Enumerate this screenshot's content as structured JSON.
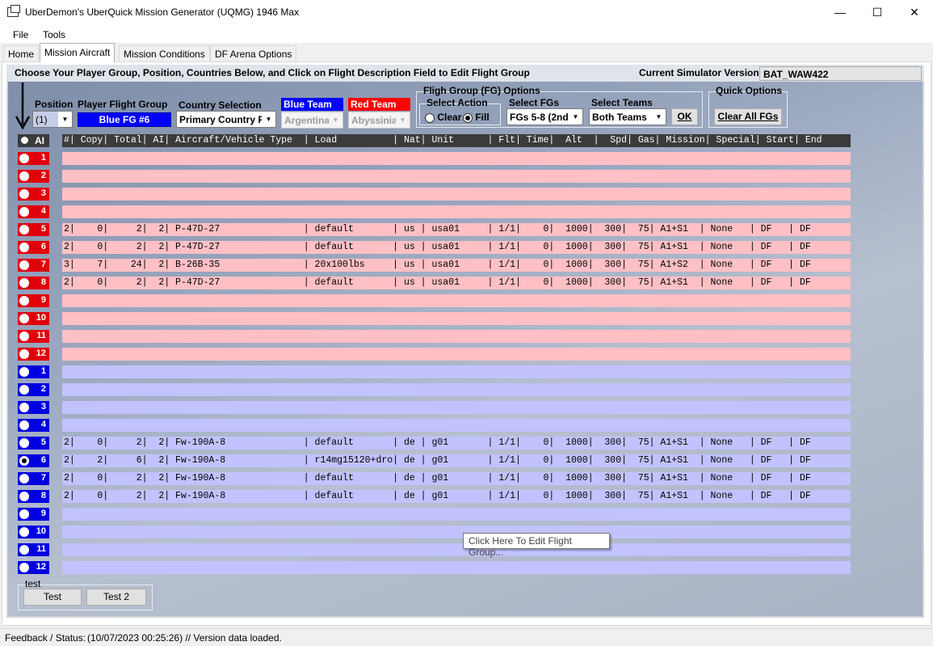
{
  "window": {
    "title": "UberDemon's UberQuick Mission Generator (UQMG) 1946 Max",
    "minimize": "—",
    "maximize": "☐",
    "close": "✕"
  },
  "menu": {
    "file": "File",
    "tools": "Tools"
  },
  "tabs": [
    "Home",
    "Mission Aircraft",
    "Mission Conditions",
    "DF Arena Options"
  ],
  "header": {
    "instructions": "Choose Your Player Group, Position, Countries Below, and Click on Flight Description Field to Edit Flight Group",
    "sim_label": "Current Simulator Version:",
    "sim_value": "BAT_WAW422"
  },
  "controls": {
    "position_label": "Position",
    "position_value": "(1)",
    "player_fg_label": "Player Flight Group",
    "player_fg_value": "Blue FG #6",
    "country_label": "Country Selection",
    "country_value": "Primary Country F",
    "blue_team_label": "Blue Team",
    "blue_team_value": "Argentina",
    "red_team_label": "Red Team",
    "red_team_value": "Abyssinia",
    "fg_options_title": "Fligh Group (FG) Options",
    "select_action_title": "Select Action",
    "clear_label": "Clear",
    "fill_label": "Fill",
    "select_fgs_label": "Select FGs",
    "select_fgs_value": "FGs 5-8  (2nd",
    "select_teams_label": "Select Teams",
    "select_teams_value": "Both Teams",
    "ok_label": "OK",
    "quick_options_title": "Quick Options",
    "clear_all_label": "Clear All FGs"
  },
  "colors": {
    "red_team": "#e0000b",
    "blue_team": "#0000e0",
    "red_row": "#ffc0c5",
    "blue_row": "#c2c2ff"
  },
  "table": {
    "all_label": "AI",
    "header": "#| Copy| Total| AI| Aircraft/Vehicle Type  | Load          | Nat| Unit      | Flt| Time|  Alt  |  Spd| Gas| Mission| Special| Start| End",
    "red_rows": [
      {
        "num": "1",
        "text": ""
      },
      {
        "num": "2",
        "text": ""
      },
      {
        "num": "3",
        "text": ""
      },
      {
        "num": "4",
        "text": ""
      },
      {
        "num": "5",
        "text": "2|    0|     2|  2| P-47D-27               | default       | us | usa01     | 1/1|    0|  1000|  300|  75| A1+S1  | None   | DF   | DF"
      },
      {
        "num": "6",
        "text": "2|    0|     2|  2| P-47D-27               | default       | us | usa01     | 1/1|    0|  1000|  300|  75| A1+S1  | None   | DF   | DF"
      },
      {
        "num": "7",
        "text": "3|    7|    24|  2| B-26B-35               | 20x100lbs     | us | usa01     | 1/1|    0|  1000|  300|  75| A1+S2  | None   | DF   | DF"
      },
      {
        "num": "8",
        "text": "2|    0|     2|  2| P-47D-27               | default       | us | usa01     | 1/1|    0|  1000|  300|  75| A1+S1  | None   | DF   | DF"
      },
      {
        "num": "9",
        "text": ""
      },
      {
        "num": "10",
        "text": ""
      },
      {
        "num": "11",
        "text": ""
      },
      {
        "num": "12",
        "text": ""
      }
    ],
    "blue_rows": [
      {
        "num": "1",
        "text": ""
      },
      {
        "num": "2",
        "text": ""
      },
      {
        "num": "3",
        "text": ""
      },
      {
        "num": "4",
        "text": ""
      },
      {
        "num": "5",
        "text": "2|    0|     2|  2| Fw-190A-8              | default       | de | g01       | 1/1|    0|  1000|  300|  75| A1+S1  | None   | DF   | DF"
      },
      {
        "num": "6",
        "text": "2|    2|     6|  2| Fw-190A-8              | r14mg15120+dro| de | g01       | 1/1|    0|  1000|  300|  75| A1+S1  | None   | DF   | DF"
      },
      {
        "num": "7",
        "text": "2|    0|     2|  2| Fw-190A-8              | default       | de | g01       | 1/1|    0|  1000|  300|  75| A1+S1  | None   | DF   | DF"
      },
      {
        "num": "8",
        "text": "2|    0|     2|  2| Fw-190A-8              | default       | de | g01       | 1/1|    0|  1000|  300|  75| A1+S1  | None   | DF   | DF"
      },
      {
        "num": "9",
        "text": ""
      },
      {
        "num": "10",
        "text": ""
      },
      {
        "num": "11",
        "text": ""
      },
      {
        "num": "12",
        "text": ""
      }
    ],
    "selected_team": "blue",
    "selected_num": "6"
  },
  "tooltip": "Click Here To Edit Flight Group...",
  "test_group": {
    "title": "test",
    "test_label": "Test",
    "test2_label": "Test 2"
  },
  "status": {
    "label": "Feedback / Status:",
    "message": "(10/07/2023 00:25:26) // Version data loaded."
  }
}
